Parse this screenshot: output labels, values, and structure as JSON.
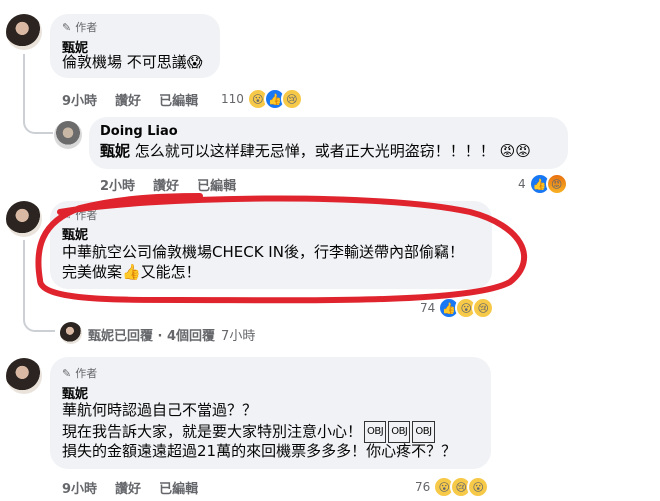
{
  "comments": [
    {
      "author_badge": "作者",
      "name": "甄妮",
      "lines": [
        "倫敦機場 不可思議😱"
      ],
      "time": "9小時",
      "like_label": "讚好",
      "edited_label": "已編輯",
      "reaction_count": "110"
    },
    {
      "name": "Doing Liao",
      "mention": "甄妮",
      "text": "怎么就可以这样肆无忌惮，或者正大光明盗窃！！！！",
      "emojis": "😡😡",
      "time": "2小時",
      "like_label": "讚好",
      "edited_label": "已編輯",
      "reaction_count": "4"
    },
    {
      "author_badge": "作者",
      "name": "甄妮",
      "line1": "中華航空公司倫敦機場CHECK IN後，行李輸送帶內部偷竊！",
      "line2": "完美做案👍又能怎！",
      "reaction_count": "74",
      "replies_text": "甄妮已回覆 · 4個回覆",
      "replies_time": "7小時"
    },
    {
      "author_badge": "作者",
      "name": "甄妮",
      "line1": "華航何時認過自己不當過？？",
      "line2": "現在我告訴大家，就是要大家特別注意小心！",
      "stamp1": "OBJ",
      "stamp2": "OBJ",
      "stamp3": "OBJ",
      "line3": "損失的金額遠遠超過21萬的來回機票多多多！你心疼不？？",
      "time": "9小時",
      "like_label": "讚好",
      "edited_label": "已編輯",
      "reaction_count": "76"
    }
  ],
  "icons": {
    "pencil": "✎"
  },
  "colors": {
    "bubble": "#f0f2f5",
    "meta": "#65676b",
    "like": "#1877f2",
    "annotation": "#e0242e"
  }
}
